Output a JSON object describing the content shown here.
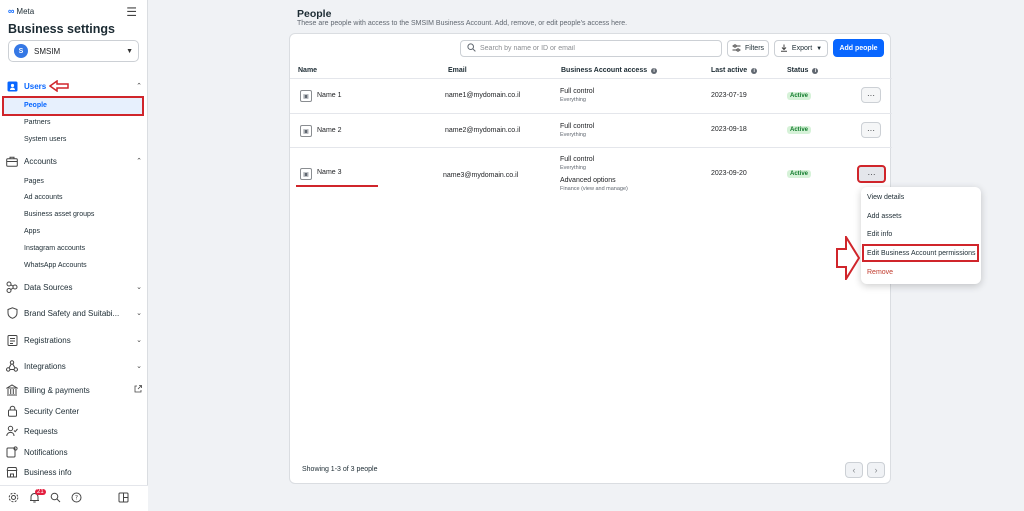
{
  "brand": {
    "logo_text": "Meta"
  },
  "sidebar": {
    "title": "Business settings",
    "account": {
      "initial": "S",
      "name": "SMSIM"
    },
    "users": {
      "label": "Users",
      "items": [
        "People",
        "Partners",
        "System users"
      ]
    },
    "accounts": {
      "label": "Accounts",
      "items": [
        "Pages",
        "Ad accounts",
        "Business asset groups",
        "Apps",
        "Instagram accounts",
        "WhatsApp Accounts"
      ]
    },
    "groups": [
      {
        "label": "Data Sources"
      },
      {
        "label": "Brand Safety and Suitabi..."
      },
      {
        "label": "Registrations"
      },
      {
        "label": "Integrations"
      },
      {
        "label": "Billing & payments"
      },
      {
        "label": "Security Center"
      },
      {
        "label": "Requests"
      },
      {
        "label": "Notifications"
      },
      {
        "label": "Business info"
      }
    ],
    "notification_badge": "21"
  },
  "main": {
    "title": "People",
    "description": "These are people with access to the SMSIM Business Account. Add, remove, or edit people's access here.",
    "search_placeholder": "Search by name or ID or email",
    "filters_label": "Filters",
    "export_label": "Export",
    "add_people_label": "Add people",
    "columns": [
      "Name",
      "Email",
      "Business Account access",
      "Last active",
      "Status"
    ],
    "rows": [
      {
        "name": "Name 1",
        "email": "name1@mydomain.co.il",
        "access": "Full control",
        "access_sub": "Everything",
        "last_active": "2023-07-19",
        "status": "Active"
      },
      {
        "name": "Name 2",
        "email": "name2@mydomain.co.il",
        "access": "Full control",
        "access_sub": "Everything",
        "last_active": "2023-09-18",
        "status": "Active"
      },
      {
        "name": "Name 3",
        "email": "name3@mydomain.co.il",
        "access": "Full control",
        "access_sub": "Everything",
        "access2": "Advanced options",
        "access2_sub": "Finance (view and manage)",
        "last_active": "2023-09-20",
        "status": "Active"
      }
    ],
    "footer": "Showing 1-3 of 3 people",
    "pager_prev": "‹",
    "pager_next": "›"
  },
  "context_menu": {
    "items": [
      "View details",
      "Add assets",
      "Edit info",
      "Edit Business Account permissions",
      "Remove"
    ]
  },
  "colors": {
    "accent": "#0866ff",
    "annotation_red": "#d0252b",
    "active_green": "#0f7a2a"
  }
}
